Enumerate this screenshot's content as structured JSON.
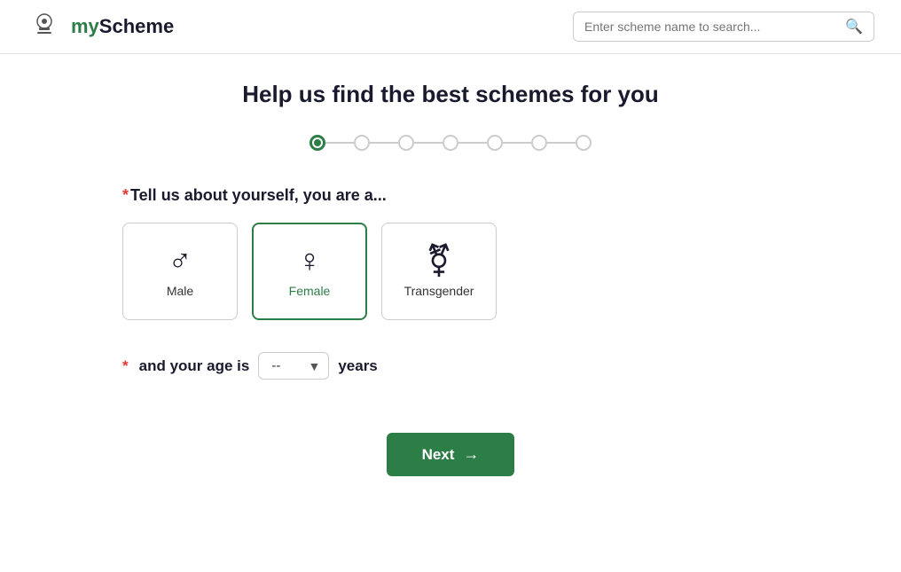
{
  "header": {
    "logo_my": "my",
    "logo_scheme": "Scheme",
    "search_placeholder": "Enter scheme name to search..."
  },
  "page": {
    "title": "Help us find the best schemes for you",
    "question": "Tell us about yourself, you are a...",
    "age_label_pre": "and your age is",
    "age_label_post": "years",
    "age_placeholder": "--",
    "next_button": "Next"
  },
  "progress": {
    "total_steps": 7,
    "active_step": 0
  },
  "gender_options": [
    {
      "id": "male",
      "label": "Male",
      "icon": "♂",
      "selected": false
    },
    {
      "id": "female",
      "label": "Female",
      "icon": "♀",
      "selected": true
    },
    {
      "id": "transgender",
      "label": "Transgender",
      "icon": "⚧",
      "selected": false
    }
  ]
}
